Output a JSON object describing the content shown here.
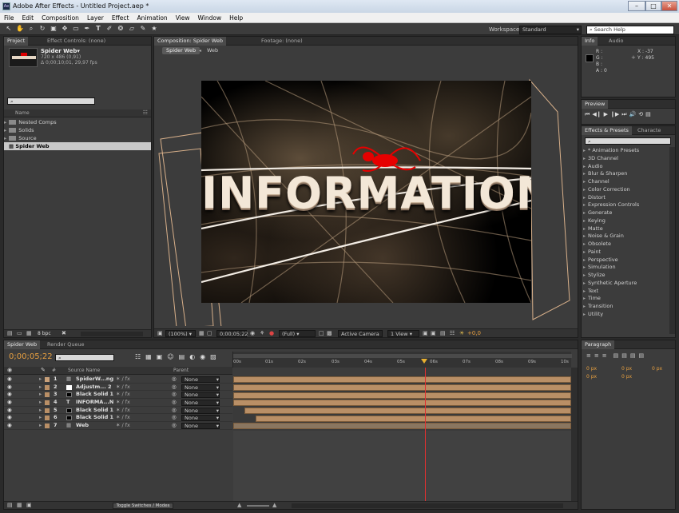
{
  "app": {
    "title": "Adobe After Effects - Untitled Project.aep *",
    "icon_label": "Ae"
  },
  "window_controls": {
    "minimize": "–",
    "maximize": "□",
    "close": "✕"
  },
  "menu": [
    "File",
    "Edit",
    "Composition",
    "Layer",
    "Effect",
    "Animation",
    "View",
    "Window",
    "Help"
  ],
  "toolbar": {
    "workspace_label": "Workspace:",
    "workspace_value": "Standard",
    "search_placeholder": "Search Help"
  },
  "project_panel": {
    "tabs": [
      "Project",
      "Effect Controls: (none)"
    ],
    "selected_item": {
      "name": "Spider Web▾",
      "size": "720 x 486 (0,91)",
      "duration": "Δ 0;00;10;01, 29,97 fps"
    },
    "column_name": "Name",
    "items": [
      "Nested Comps",
      "Solids",
      "Source",
      "Spider Web"
    ],
    "footer_bpc": "8 bpc"
  },
  "comp_panel": {
    "tabs": [
      "Composition: Spider Web",
      "Footage: (none)"
    ],
    "breadcrumbs": [
      "Spider Web",
      "Web"
    ],
    "hero_text": "INFORMATION",
    "zoom": "(100%)",
    "timecode": "0;00;05;22",
    "resolution": "(Full)",
    "camera": "Active Camera",
    "view": "1 View",
    "exposure": "+0,0"
  },
  "info_panel": {
    "tabs": [
      "Info",
      "Audio"
    ],
    "r": "R :",
    "g": "G :",
    "b": "B :",
    "a": "A : 0",
    "x": "X : -37",
    "y": "Y : 495"
  },
  "preview_panel": {
    "tab": "Preview",
    "controls": [
      "⏮",
      "◀❙",
      "▶",
      "❙▶",
      "⏭",
      "🔊",
      "⟲",
      "▤"
    ]
  },
  "effects_panel": {
    "tabs": [
      "Effects & Presets",
      "Characte"
    ],
    "search_placeholder": "⌕",
    "items": [
      "* Animation Presets",
      "3D Channel",
      "Audio",
      "Blur & Sharpen",
      "Channel",
      "Color Correction",
      "Distort",
      "Expression Controls",
      "Generate",
      "Keying",
      "Matte",
      "Noise & Grain",
      "Obsolete",
      "Paint",
      "Perspective",
      "Simulation",
      "Stylize",
      "Synthetic Aperture",
      "Text",
      "Time",
      "Transition",
      "Utility"
    ]
  },
  "paragraph_panel": {
    "tab": "Paragraph",
    "fields": [
      "0 px",
      "0 px",
      "0 px",
      "0 px",
      "0 px"
    ]
  },
  "timeline": {
    "tabs": [
      "Spider Web",
      "Render Queue"
    ],
    "timecode": "0;00;05;22",
    "columns": {
      "num": "#",
      "source": "Source Name",
      "parent": "Parent"
    },
    "ruler": [
      "00s",
      "01s",
      "02s",
      "03s",
      "04s",
      "05s",
      "06s",
      "07s",
      "08s",
      "09s",
      "10s"
    ],
    "layers": [
      {
        "num": "1",
        "name": "SpiderW...ng",
        "parent": "None",
        "color": "#c8a07a",
        "type": "comp"
      },
      {
        "num": "2",
        "name": "Adjustm... 2",
        "parent": "None",
        "color": "#b98f66",
        "type": "solid-white"
      },
      {
        "num": "3",
        "name": "Black Solid 1",
        "parent": "None",
        "color": "#b98f66",
        "type": "solid-black"
      },
      {
        "num": "4",
        "name": "INFORMA...N",
        "parent": "None",
        "color": "#b98f66",
        "type": "text"
      },
      {
        "num": "5",
        "name": "Black Solid 1",
        "parent": "None",
        "color": "#b98f66",
        "type": "solid-black"
      },
      {
        "num": "6",
        "name": "Black Solid 1",
        "parent": "None",
        "color": "#b98f66",
        "type": "solid-black"
      },
      {
        "num": "7",
        "name": "Web",
        "parent": "None",
        "color": "#b98f66",
        "type": "comp"
      }
    ],
    "footer_toggle": "Toggle Switches / Modes"
  }
}
